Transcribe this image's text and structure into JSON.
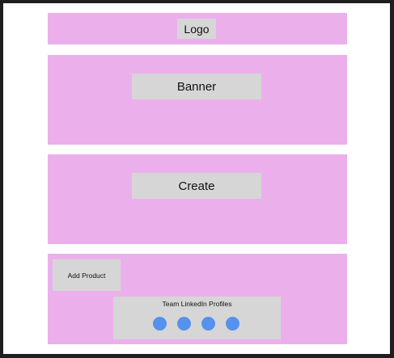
{
  "header": {
    "logo_label": "Logo"
  },
  "banner": {
    "label": "Banner"
  },
  "create": {
    "label": "Create"
  },
  "footer": {
    "add_product_label": "Add Product",
    "team": {
      "title": "Team LinkedIn Profiles",
      "profile_icons": [
        "profile-circle-icon",
        "profile-circle-icon",
        "profile-circle-icon",
        "profile-circle-icon"
      ]
    }
  },
  "colors": {
    "section_background": "#ebb0ec",
    "placeholder_box": "#d6d6d6",
    "profile_circle": "#5592ee",
    "canvas_background": "#ffffff",
    "outer_border": "#1e1e1e"
  }
}
